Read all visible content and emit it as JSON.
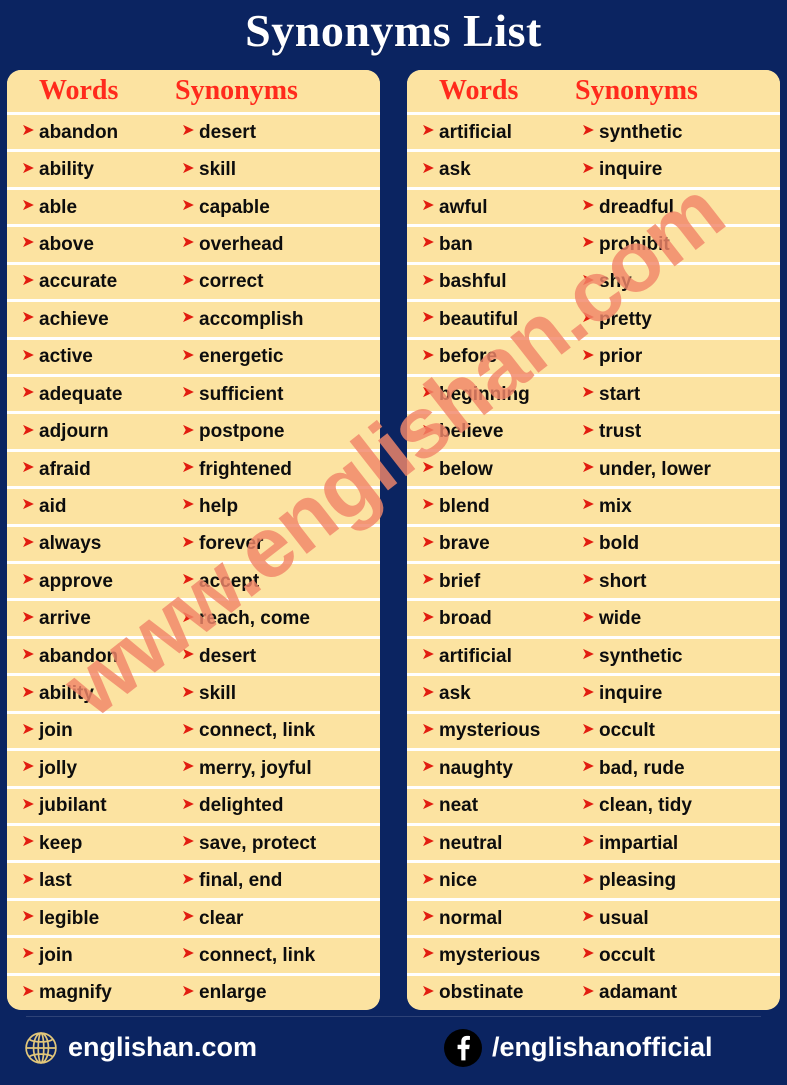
{
  "title": "Synonyms List",
  "colors": {
    "background": "#0b2461",
    "card": "#fce3a1",
    "header_text": "#ff2a1c",
    "bullet": "#e21d10",
    "row_text": "#0d0d0d",
    "title_text": "#ffffff",
    "watermark": "#f2876a",
    "globe": "#e2c77a"
  },
  "watermark": {
    "text": "www.englishan.com"
  },
  "columns": {
    "words": "Words",
    "synonyms": "Synonyms"
  },
  "left_card": {
    "header": {
      "words": "Words",
      "synonyms": "Synonyms"
    },
    "rows": [
      {
        "word": "abandon",
        "synonym": "desert"
      },
      {
        "word": "ability",
        "synonym": "skill"
      },
      {
        "word": "able",
        "synonym": "capable"
      },
      {
        "word": "above",
        "synonym": "overhead"
      },
      {
        "word": "accurate",
        "synonym": "correct"
      },
      {
        "word": "achieve",
        "synonym": "accomplish"
      },
      {
        "word": "active",
        "synonym": "energetic"
      },
      {
        "word": "adequate",
        "synonym": "sufficient"
      },
      {
        "word": "adjourn",
        "synonym": "postpone"
      },
      {
        "word": "afraid",
        "synonym": "frightened"
      },
      {
        "word": "aid",
        "synonym": "help"
      },
      {
        "word": "always",
        "synonym": "forever"
      },
      {
        "word": "approve",
        "synonym": "accept"
      },
      {
        "word": "arrive",
        "synonym": "reach, come"
      },
      {
        "word": "abandon",
        "synonym": "desert"
      },
      {
        "word": "ability",
        "synonym": "skill"
      },
      {
        "word": "join",
        "synonym": "connect, link"
      },
      {
        "word": "jolly",
        "synonym": "merry, joyful"
      },
      {
        "word": "jubilant",
        "synonym": "delighted"
      },
      {
        "word": "keep",
        "synonym": "save, protect"
      },
      {
        "word": "last",
        "synonym": "final, end"
      },
      {
        "word": "legible",
        "synonym": "clear"
      },
      {
        "word": "join",
        "synonym": "connect, link"
      },
      {
        "word": "magnify",
        "synonym": "enlarge"
      }
    ]
  },
  "right_card": {
    "header": {
      "words": "Words",
      "synonyms": "Synonyms"
    },
    "rows": [
      {
        "word": "artificial",
        "synonym": "synthetic"
      },
      {
        "word": "ask",
        "synonym": "inquire"
      },
      {
        "word": "awful",
        "synonym": "dreadful"
      },
      {
        "word": "ban",
        "synonym": "prohibit"
      },
      {
        "word": "bashful",
        "synonym": "shy"
      },
      {
        "word": "beautiful",
        "synonym": "pretty"
      },
      {
        "word": "before",
        "synonym": "prior"
      },
      {
        "word": "beginning",
        "synonym": "start"
      },
      {
        "word": "believe",
        "synonym": "trust"
      },
      {
        "word": "below",
        "synonym": "under, lower"
      },
      {
        "word": "blend",
        "synonym": "mix"
      },
      {
        "word": "brave",
        "synonym": "bold"
      },
      {
        "word": "brief",
        "synonym": "short"
      },
      {
        "word": "broad",
        "synonym": "wide"
      },
      {
        "word": "artificial",
        "synonym": "synthetic"
      },
      {
        "word": "ask",
        "synonym": "inquire"
      },
      {
        "word": "mysterious",
        "synonym": "occult"
      },
      {
        "word": "naughty",
        "synonym": "bad, rude"
      },
      {
        "word": "neat",
        "synonym": "clean, tidy"
      },
      {
        "word": "neutral",
        "synonym": "impartial"
      },
      {
        "word": "nice",
        "synonym": "pleasing"
      },
      {
        "word": "normal",
        "synonym": "usual"
      },
      {
        "word": "mysterious",
        "synonym": "occult"
      },
      {
        "word": "obstinate",
        "synonym": "adamant"
      }
    ]
  },
  "footer": {
    "website": "englishan.com",
    "website_icon": "globe-icon",
    "facebook": "/englishanofficial",
    "facebook_icon": "facebook-icon"
  },
  "bullet_glyph": "➤"
}
